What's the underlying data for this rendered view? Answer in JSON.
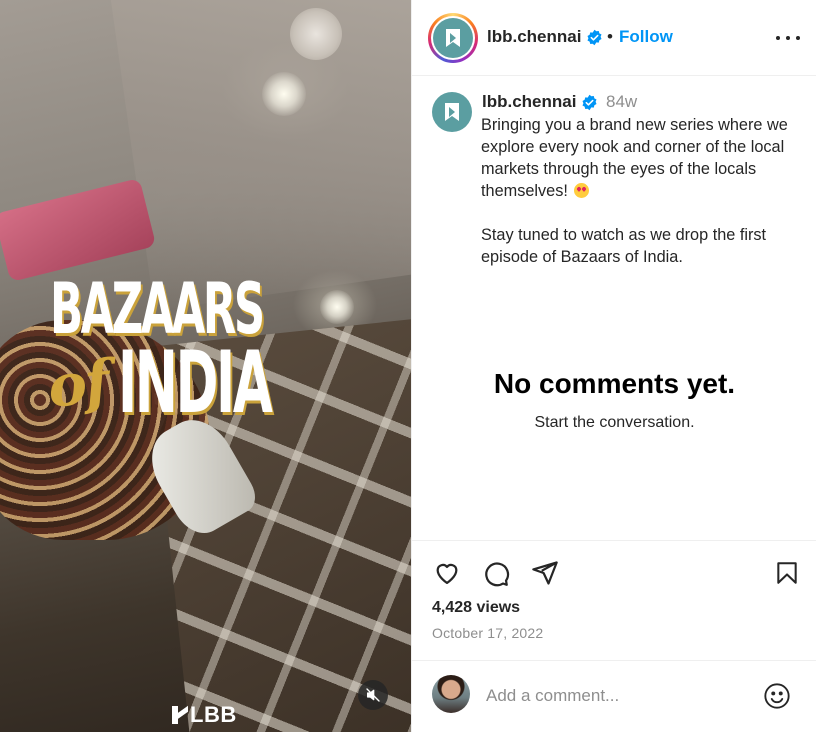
{
  "media": {
    "title_line1": "BAZAARS",
    "title_of": "of",
    "title_line2": "INDIA",
    "brand_logo": "LBB",
    "mute_icon": "speaker-muted-icon"
  },
  "header": {
    "username": "lbb.chennai",
    "verified_icon": "verified-badge-icon",
    "separator": "•",
    "follow_label": "Follow",
    "more_icon": "more-options-icon"
  },
  "caption": {
    "username": "lbb.chennai",
    "time": "84w",
    "paragraph1": "Bringing you a brand new series where we explore every nook and corner of the local markets through the eyes of the locals themselves!",
    "emoji": "heart-eyes-emoji",
    "paragraph2": "Stay tuned to watch as we drop the first episode of Bazaars of India."
  },
  "comments": {
    "empty_title": "No comments yet.",
    "empty_subtitle": "Start the conversation."
  },
  "actions": {
    "like_icon": "heart-icon",
    "comment_icon": "comment-icon",
    "share_icon": "share-icon",
    "save_icon": "bookmark-icon",
    "views": "4,428 views",
    "date": "October 17, 2022"
  },
  "comment_bar": {
    "placeholder": "Add a comment...",
    "emoji_icon": "smiley-icon"
  },
  "colors": {
    "accent": "#0095f6",
    "brand_teal": "#5b9ea1",
    "title_gold": "#d2a63c"
  }
}
